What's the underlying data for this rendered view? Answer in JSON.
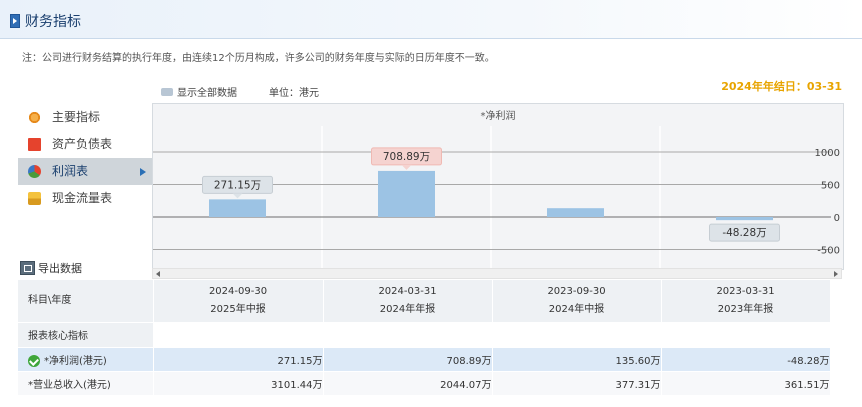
{
  "header": {
    "title": "财务指标"
  },
  "note": "注：公司进行财务结算的执行年度，由连续12个历月构成，许多公司的财务年度与实际的日历年度不一致。",
  "year_end": "2024年年结日：03-31",
  "toolbar": {
    "show_all": "显示全部数据",
    "unit": "单位：港元"
  },
  "sidebar": {
    "items": [
      {
        "label": "主要指标",
        "icon": "gear-coin-icon"
      },
      {
        "label": "资产负债表",
        "icon": "red-doc-icon"
      },
      {
        "label": "利润表",
        "icon": "pie-icon",
        "active": true
      },
      {
        "label": "现金流量表",
        "icon": "cash-icon"
      }
    ]
  },
  "export_label": "导出数据",
  "chart_data": {
    "type": "bar",
    "title": "*净利润",
    "categories": [
      "2024-09-30",
      "2024-03-31",
      "2023-09-30",
      "2023-03-31"
    ],
    "values": [
      271.15,
      708.89,
      135.6,
      -48.28
    ],
    "data_labels": [
      "271.15万",
      "708.89万",
      "",
      "-48.28万"
    ],
    "yticks": [
      1000,
      500,
      0,
      -500
    ],
    "ylim": [
      -800,
      1400
    ],
    "y_axis_position": "right",
    "grid": true,
    "colors": {
      "bar": "#9cc3e4",
      "label_bg": "#dde3e8",
      "label_hl_bg": "#f5d3d0"
    }
  },
  "table": {
    "corner": "科目\\年度",
    "columns": [
      {
        "date": "2024-09-30",
        "period": "2025年中报"
      },
      {
        "date": "2024-03-31",
        "period": "2024年年报"
      },
      {
        "date": "2023-09-30",
        "period": "2024年中报"
      },
      {
        "date": "2023-03-31",
        "period": "2023年年报"
      }
    ],
    "section": "报表核心指标",
    "rows": [
      {
        "label": "*净利润(港元)",
        "values": [
          "271.15万",
          "708.89万",
          "135.60万",
          "-48.28万"
        ]
      },
      {
        "label": "*营业总收入(港元)",
        "values": [
          "3101.44万",
          "2044.07万",
          "377.31万",
          "361.51万"
        ]
      }
    ]
  }
}
